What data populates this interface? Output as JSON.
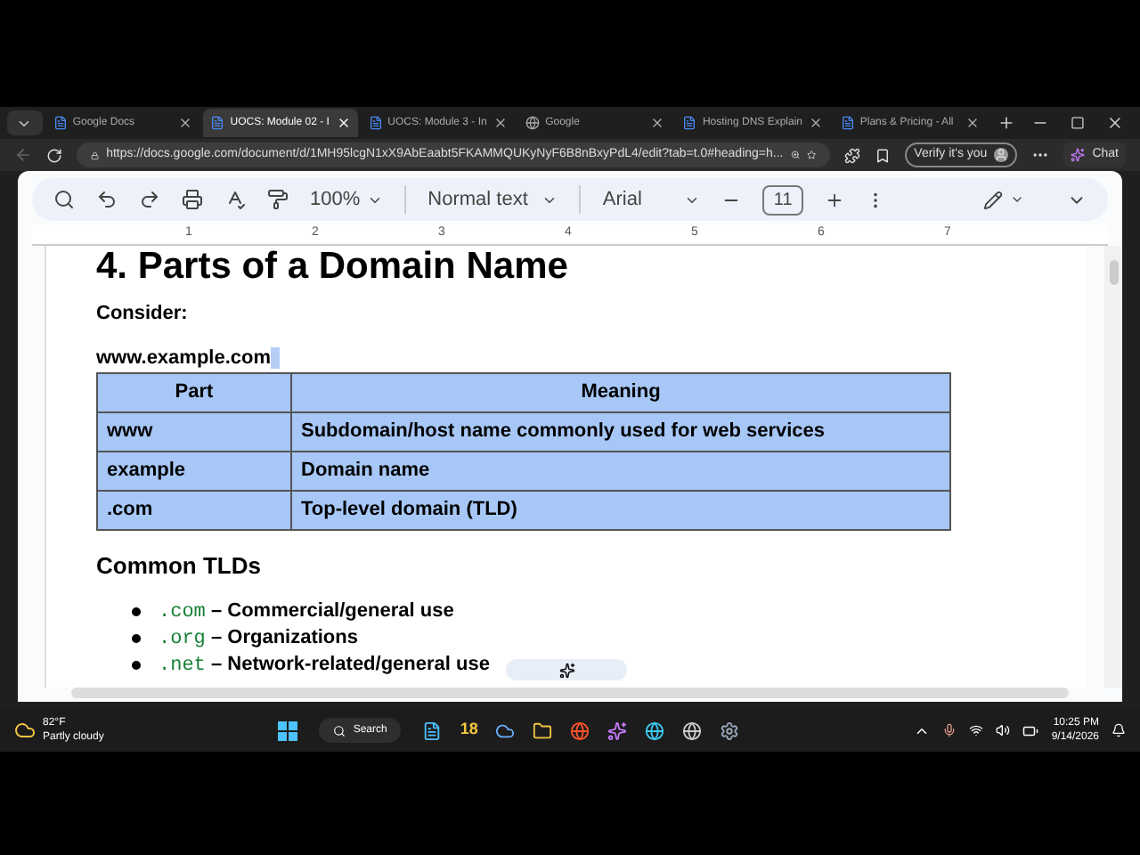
{
  "tabs": [
    {
      "label": "Google Docs",
      "selected": false
    },
    {
      "label": "UOCS: Module 02 - I",
      "selected": true
    },
    {
      "label": "UOCS: Module 3 - In",
      "selected": false
    },
    {
      "label": "Google",
      "selected": false
    },
    {
      "label": "Hosting DNS Explain",
      "selected": false
    },
    {
      "label": "Plans & Pricing - All",
      "selected": false
    }
  ],
  "address_bar": {
    "url": "https://docs.google.com/document/d/1MH95lcgN1xX9AbEaabt5FKAMMQUKyNyF6B8nBxyPdL4/edit?tab=t.0#heading=h...",
    "profile_button": "Verify it's you",
    "chat_button": "Chat"
  },
  "toolbar": {
    "zoom": "100%",
    "style": "Normal text",
    "font": "Arial",
    "font_size": "11"
  },
  "ruler": {
    "marks": [
      "1",
      "2",
      "3",
      "4",
      "5",
      "6",
      "7"
    ]
  },
  "document": {
    "heading": "4. Parts of a Domain Name",
    "intro": "Consider:",
    "example": "www.example.com",
    "table": {
      "columns": [
        "Part",
        "Meaning"
      ],
      "rows": [
        [
          "www",
          "Subdomain/host name commonly used for web services"
        ],
        [
          "example",
          "Domain name"
        ],
        [
          ".com",
          "Top-level domain (TLD)"
        ]
      ]
    },
    "subheading": "Common TLDs",
    "bullets": [
      {
        "code": ".com",
        "text": "– Commercial/general use"
      },
      {
        "code": ".org",
        "text": "– Organizations"
      },
      {
        "code": ".net",
        "text": "– Network-related/general use"
      }
    ]
  },
  "taskbar": {
    "temperature": "82°F",
    "weather": "Partly cloudy",
    "search": "Search",
    "badge_app": "18",
    "time": "10:25 PM",
    "date": "9/14/2026"
  }
}
